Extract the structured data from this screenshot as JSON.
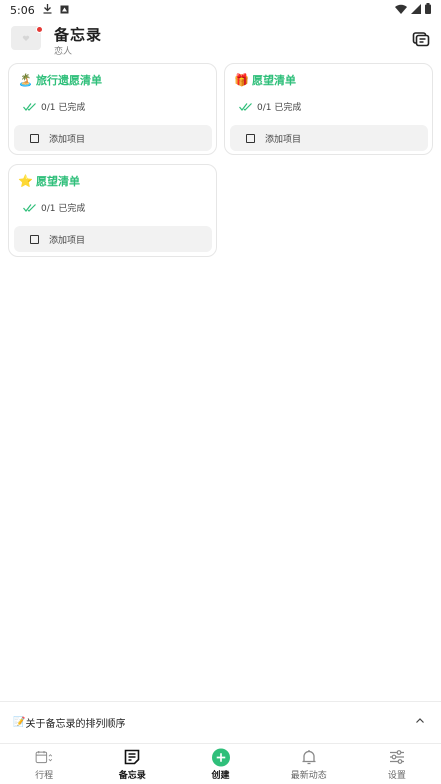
{
  "status_bar": {
    "time": "5:06"
  },
  "header": {
    "title": "备忘录",
    "subtitle": "恋人"
  },
  "cards": [
    {
      "emoji": "🏝️",
      "title": "旅行遗愿清单",
      "progress": "0/1 已完成",
      "add_label": "添加项目"
    },
    {
      "emoji": "🎁",
      "title": "愿望清单",
      "progress": "0/1 已完成",
      "add_label": "添加项目"
    },
    {
      "emoji": "⭐",
      "title": "愿望清单",
      "progress": "0/1 已完成",
      "add_label": "添加项目"
    }
  ],
  "sort_banner": {
    "emoji": "📝",
    "text": "关于备忘录的排列顺序"
  },
  "nav": [
    {
      "label": "行程",
      "icon": "calendar-icon"
    },
    {
      "label": "备忘录",
      "icon": "memo-icon",
      "active": true
    },
    {
      "label": "创建",
      "icon": "plus-circle-icon"
    },
    {
      "label": "最新动态",
      "icon": "bell-icon"
    },
    {
      "label": "设置",
      "icon": "sliders-icon"
    }
  ],
  "colors": {
    "accent": "#2fbf7a",
    "card_border": "#e6e6e6",
    "add_row_bg": "#f2f2f2"
  }
}
